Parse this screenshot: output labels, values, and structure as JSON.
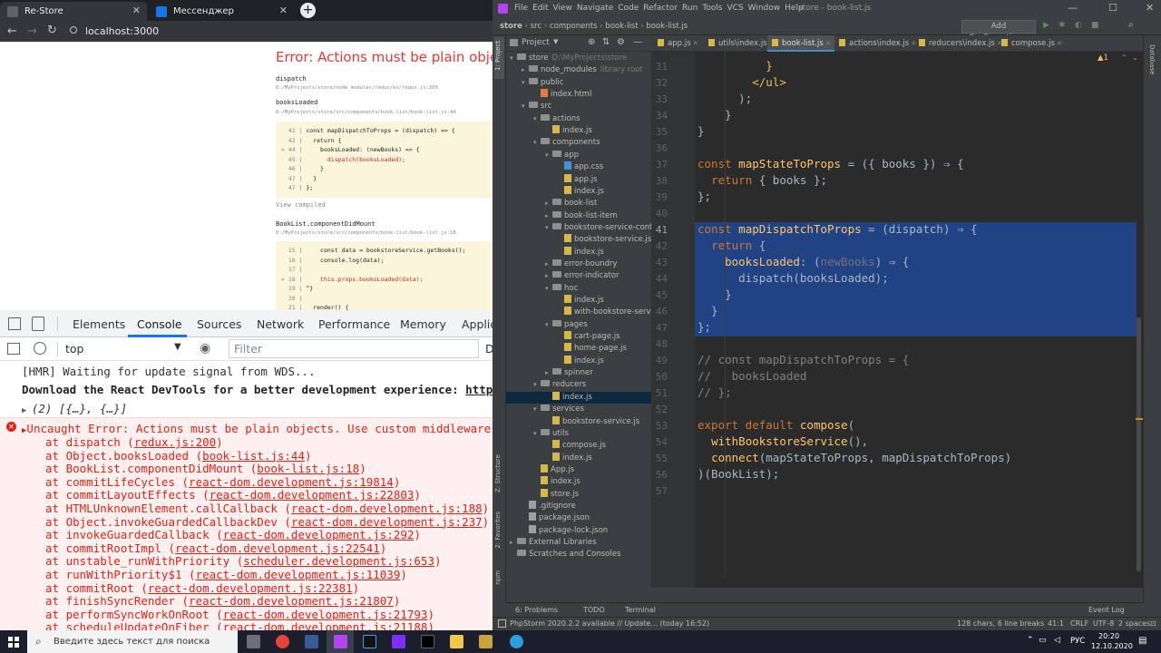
{
  "chrome": {
    "tabs": [
      {
        "title": "Re-Store",
        "active": true
      },
      {
        "title": "Мессенджер",
        "active": false
      }
    ],
    "new_tab": "+",
    "url": "localhost:3000",
    "overlay": {
      "title": "Error: Actions must be plain objects.",
      "frames": [
        {
          "label": "dispatch",
          "path": "D:/MyProjects/store/node_modules/redux/es/redux.js:200"
        },
        {
          "label": "booksLoaded",
          "path": "D:/MyProjects/store/src/components/book-list/book-list.js:44"
        },
        {
          "label": "BookList.componentDidMount",
          "path": "D:/MyProjects/store/src/components/book-list/book-list.js:18"
        }
      ],
      "code1": [
        {
          "ln": "  41 |",
          "code": " const mapDispatchToProps = (dispatch) => {",
          "hl": false
        },
        {
          "ln": "  42 |",
          "code": "   return {",
          "hl": false
        },
        {
          "ln": "> 44 |",
          "code": "     booksLoaded: (newBooks) => {",
          "hl": false
        },
        {
          "ln": "  45 |",
          "code": "       dispatch(booksLoaded);",
          "hl": true
        },
        {
          "ln": "  46 |",
          "code": "     }",
          "hl": false
        },
        {
          "ln": "  47 |",
          "code": "   }",
          "hl": false
        },
        {
          "ln": "  47 |",
          "code": " };",
          "hl": false
        }
      ],
      "view_compiled": "View compiled",
      "code2": [
        {
          "ln": "  15 |",
          "code": "     const data = bookstoreService.getBooks();",
          "hl": false
        },
        {
          "ln": "  16 |",
          "code": "     console.log(data);",
          "hl": false
        },
        {
          "ln": "  17 |",
          "code": "",
          "hl": false
        },
        {
          "ln": "> 18 |",
          "code": "     this.props.booksLoaded(data);",
          "hl": true
        },
        {
          "ln": "  19 |",
          "code": " ^}",
          "hl": false
        },
        {
          "ln": "  20 |",
          "code": "",
          "hl": false
        },
        {
          "ln": "  21 |",
          "code": "   render() {",
          "hl": false
        }
      ]
    },
    "devtools": {
      "tabs": [
        "Elements",
        "Console",
        "Sources",
        "Network",
        "Performance",
        "Memory",
        "Applic"
      ],
      "active_tab": "Console",
      "context": "top",
      "filter_placeholder": "Filter",
      "default_levels": "D"
    },
    "console": {
      "hmr": "[HMR] Waiting for update signal from WDS...",
      "devtools_prefix": "Download the React DevTools for a better development experience: ",
      "devtools_link": "https://fb.me/",
      "array_log": "(2) [{…}, {…}]",
      "error_line": "Uncaught Error: Actions must be plain objects. Use custom middleware for asyn",
      "stack": [
        {
          "fn": "at dispatch (",
          "loc": "redux.js:200",
          "end": ")"
        },
        {
          "fn": "at Object.booksLoaded (",
          "loc": "book-list.js:44",
          "end": ")"
        },
        {
          "fn": "at BookList.componentDidMount (",
          "loc": "book-list.js:18",
          "end": ")"
        },
        {
          "fn": "at commitLifeCycles (",
          "loc": "react-dom.development.js:19814",
          "end": ")"
        },
        {
          "fn": "at commitLayoutEffects (",
          "loc": "react-dom.development.js:22803",
          "end": ")"
        },
        {
          "fn": "at HTMLUnknownElement.callCallback (",
          "loc": "react-dom.development.js:188",
          "end": ")"
        },
        {
          "fn": "at Object.invokeGuardedCallbackDev (",
          "loc": "react-dom.development.js:237",
          "end": ")"
        },
        {
          "fn": "at invokeGuardedCallback (",
          "loc": "react-dom.development.js:292",
          "end": ")"
        },
        {
          "fn": "at commitRootImpl (",
          "loc": "react-dom.development.js:22541",
          "end": ")"
        },
        {
          "fn": "at unstable_runWithPriority (",
          "loc": "scheduler.development.js:653",
          "end": ")"
        },
        {
          "fn": "at runWithPriority$1 (",
          "loc": "react-dom.development.js:11039",
          "end": ")"
        },
        {
          "fn": "at commitRoot (",
          "loc": "react-dom.development.js:22381",
          "end": ")"
        },
        {
          "fn": "at finishSyncRender (",
          "loc": "react-dom.development.js:21807",
          "end": ")"
        },
        {
          "fn": "at performSyncWorkOnRoot (",
          "loc": "react-dom.development.js:21793",
          "end": ")"
        },
        {
          "fn": "at scheduleUpdateOnFiber (",
          "loc": "react-dom.development.js:21188",
          "end": ")"
        }
      ]
    }
  },
  "ide": {
    "menu": [
      "File",
      "Edit",
      "View",
      "Navigate",
      "Code",
      "Refactor",
      "Run",
      "Tools",
      "VCS",
      "Window",
      "Help"
    ],
    "window_title": "store - book-list.js",
    "breadcrumbs": [
      "store",
      "src",
      "components",
      "book-list",
      "book-list.js"
    ],
    "add_config": "Add Configuration...",
    "project_label": "Project",
    "left_stripe": [
      "1: Project",
      "Z: Structure",
      "2: Favorites",
      "npm"
    ],
    "right_stripe": [
      "Database"
    ],
    "tree": [
      {
        "d": 0,
        "t": "folder",
        "open": true,
        "name": "store",
        "extra": "D:\\MyProjects\\store"
      },
      {
        "d": 1,
        "t": "folder",
        "open": false,
        "name": "node_modules",
        "extra": "library root"
      },
      {
        "d": 1,
        "t": "folder",
        "open": true,
        "name": "public",
        "extra": ""
      },
      {
        "d": 2,
        "t": "html",
        "open": null,
        "name": "index.html",
        "extra": ""
      },
      {
        "d": 1,
        "t": "folder",
        "open": true,
        "name": "src",
        "extra": ""
      },
      {
        "d": 2,
        "t": "folder",
        "open": true,
        "name": "actions",
        "extra": ""
      },
      {
        "d": 3,
        "t": "js",
        "open": null,
        "name": "index.js",
        "extra": ""
      },
      {
        "d": 2,
        "t": "folder",
        "open": true,
        "name": "components",
        "extra": ""
      },
      {
        "d": 3,
        "t": "folder",
        "open": true,
        "name": "app",
        "extra": ""
      },
      {
        "d": 4,
        "t": "css",
        "open": null,
        "name": "app.css",
        "extra": ""
      },
      {
        "d": 4,
        "t": "js",
        "open": null,
        "name": "app.js",
        "extra": ""
      },
      {
        "d": 4,
        "t": "js",
        "open": null,
        "name": "index.js",
        "extra": ""
      },
      {
        "d": 3,
        "t": "folder",
        "open": false,
        "name": "book-list",
        "extra": ""
      },
      {
        "d": 3,
        "t": "folder",
        "open": false,
        "name": "book-list-item",
        "extra": ""
      },
      {
        "d": 3,
        "t": "folder",
        "open": true,
        "name": "bookstore-service-context",
        "extra": ""
      },
      {
        "d": 4,
        "t": "js",
        "open": null,
        "name": "bookstore-service.js",
        "extra": ""
      },
      {
        "d": 4,
        "t": "js",
        "open": null,
        "name": "index.js",
        "extra": ""
      },
      {
        "d": 3,
        "t": "folder",
        "open": false,
        "name": "error-boundry",
        "extra": ""
      },
      {
        "d": 3,
        "t": "folder",
        "open": false,
        "name": "error-indicator",
        "extra": ""
      },
      {
        "d": 3,
        "t": "folder",
        "open": true,
        "name": "hoc",
        "extra": ""
      },
      {
        "d": 4,
        "t": "js",
        "open": null,
        "name": "index.js",
        "extra": ""
      },
      {
        "d": 4,
        "t": "js",
        "open": null,
        "name": "with-bookstore-service.",
        "extra": ""
      },
      {
        "d": 3,
        "t": "folder",
        "open": true,
        "name": "pages",
        "extra": ""
      },
      {
        "d": 4,
        "t": "js",
        "open": null,
        "name": "cart-page.js",
        "extra": ""
      },
      {
        "d": 4,
        "t": "js",
        "open": null,
        "name": "home-page.js",
        "extra": ""
      },
      {
        "d": 4,
        "t": "js",
        "open": null,
        "name": "index.js",
        "extra": ""
      },
      {
        "d": 3,
        "t": "folder",
        "open": false,
        "name": "spinner",
        "extra": ""
      },
      {
        "d": 2,
        "t": "folder",
        "open": true,
        "name": "reducers",
        "extra": ""
      },
      {
        "d": 3,
        "t": "js",
        "open": null,
        "name": "index.js",
        "extra": "",
        "sel": true
      },
      {
        "d": 2,
        "t": "folder",
        "open": true,
        "name": "services",
        "extra": ""
      },
      {
        "d": 3,
        "t": "js",
        "open": null,
        "name": "bookstore-service.js",
        "extra": ""
      },
      {
        "d": 2,
        "t": "folder",
        "open": true,
        "name": "utils",
        "extra": ""
      },
      {
        "d": 3,
        "t": "js",
        "open": null,
        "name": "compose.js",
        "extra": ""
      },
      {
        "d": 3,
        "t": "js",
        "open": null,
        "name": "index.js",
        "extra": ""
      },
      {
        "d": 2,
        "t": "js",
        "open": null,
        "name": "App.js",
        "extra": ""
      },
      {
        "d": 2,
        "t": "js",
        "open": null,
        "name": "index.js",
        "extra": ""
      },
      {
        "d": 2,
        "t": "js",
        "open": null,
        "name": "store.js",
        "extra": ""
      },
      {
        "d": 1,
        "t": "git",
        "open": null,
        "name": ".gitignore",
        "extra": ""
      },
      {
        "d": 1,
        "t": "json",
        "open": null,
        "name": "package.json",
        "extra": ""
      },
      {
        "d": 1,
        "t": "json",
        "open": null,
        "name": "package-lock.json",
        "extra": ""
      },
      {
        "d": 0,
        "t": "folder",
        "open": false,
        "name": "External Libraries",
        "extra": ""
      },
      {
        "d": 0,
        "t": "folder",
        "open": null,
        "name": "Scratches and Consoles",
        "extra": ""
      }
    ],
    "editor_tabs": [
      {
        "name": "app.js",
        "active": false
      },
      {
        "name": "utils\\index.js",
        "active": false
      },
      {
        "name": "book-list.js",
        "active": true
      },
      {
        "name": "actions\\index.js",
        "active": false
      },
      {
        "name": "reducers\\index.js",
        "active": false
      },
      {
        "name": "compose.js",
        "active": false
      }
    ],
    "warnings": "▲1",
    "lines": [
      {
        "n": "31",
        "sel": false,
        "html": "          <span class='tg'>}</span>"
      },
      {
        "n": "32",
        "sel": false,
        "html": "        <span class='tg'>&lt;/ul&gt;</span>"
      },
      {
        "n": "33",
        "sel": false,
        "html": "      );"
      },
      {
        "n": "34",
        "sel": false,
        "html": "    }"
      },
      {
        "n": "35",
        "sel": false,
        "html": "}"
      },
      {
        "n": "36",
        "sel": false,
        "html": ""
      },
      {
        "n": "37",
        "sel": false,
        "html": "<span class='kw'>const</span> <span class='fn'>mapStateToProps</span> = ({ books }) ⇒ {"
      },
      {
        "n": "38",
        "sel": false,
        "html": "  <span class='kw'>return</span> { books };"
      },
      {
        "n": "39",
        "sel": false,
        "html": "};"
      },
      {
        "n": "40",
        "sel": false,
        "html": ""
      },
      {
        "n": "41",
        "sel": true,
        "html": "<span class='kw'>const</span> <span class='fn'>mapDispatchToProps</span> = (dispatch) ⇒ {"
      },
      {
        "n": "42",
        "sel": true,
        "html": "  <span class='kw'>return</span> {"
      },
      {
        "n": "43",
        "sel": true,
        "html": "    <span class='fn'>booksLoaded</span>: (<span class='pm'>newBooks</span>) ⇒ {"
      },
      {
        "n": "44",
        "sel": true,
        "html": "      dispatch(booksLoaded);"
      },
      {
        "n": "45",
        "sel": true,
        "html": "    }"
      },
      {
        "n": "46",
        "sel": true,
        "html": "  }"
      },
      {
        "n": "47",
        "sel": true,
        "html": "};"
      },
      {
        "n": "48",
        "sel": false,
        "html": ""
      },
      {
        "n": "49",
        "sel": false,
        "html": "<span class='cm'>// const mapDispatchToProps = {</span>"
      },
      {
        "n": "50",
        "sel": false,
        "html": "<span class='cm'>//   booksLoaded</span>"
      },
      {
        "n": "51",
        "sel": false,
        "html": "<span class='cm'>// };</span>"
      },
      {
        "n": "52",
        "sel": false,
        "html": ""
      },
      {
        "n": "53",
        "sel": false,
        "html": "<span class='kw'>export default</span> <span class='fn'>compose</span>("
      },
      {
        "n": "54",
        "sel": false,
        "html": "  <span class='fn'>withBookstoreService</span>(),"
      },
      {
        "n": "55",
        "sel": false,
        "html": "  <span class='fn'>connect</span>(mapStateToProps, mapDispatchToProps)"
      },
      {
        "n": "56",
        "sel": false,
        "html": ")(BookList);"
      },
      {
        "n": "57",
        "sel": false,
        "html": ""
      }
    ],
    "bottom_tools": [
      "6: Problems",
      "TODO",
      "Terminal"
    ],
    "event_log": "Event Log",
    "status_left": "PhpStorm 2020.2.2 available // Update... (today 16:52)",
    "status_right": [
      "128 chars, 6 line breaks",
      "41:1",
      "CRLF",
      "UTF-8",
      "2 spaces"
    ]
  },
  "taskbar": {
    "search_placeholder": "Введите здесь текст для поиска",
    "lang": "РУС",
    "time": "20:20",
    "date": "12.10.2020"
  },
  "colors": {
    "chrome_dark": "#202124",
    "error_red": "#e0241b",
    "ide_bg": "#2b2b2b",
    "selection": "#214283"
  }
}
